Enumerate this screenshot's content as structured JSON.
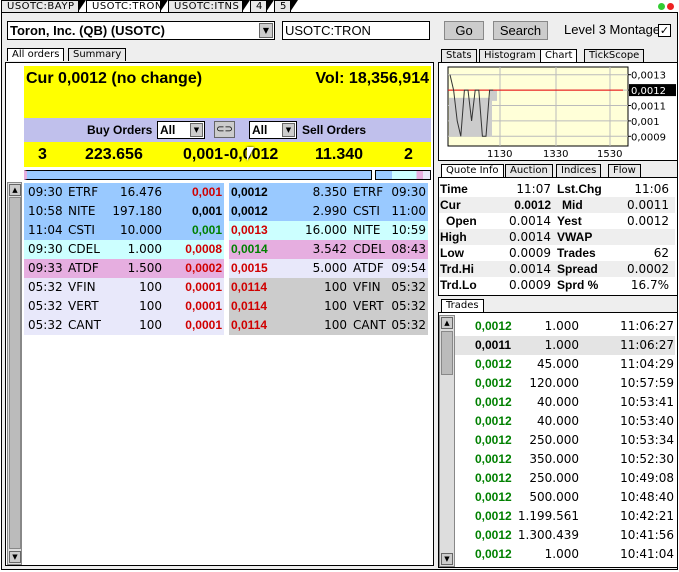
{
  "top_tabs": [
    "USOTC:BAYP",
    "USOTC:TRON",
    "USOTC:ITNS",
    "4",
    "5"
  ],
  "active_top_tab": 1,
  "symbol": {
    "name": "Toron, Inc. (QB) (USOTC)",
    "input": "USOTC:TRON",
    "go": "Go",
    "search": "Search",
    "montage_label": "Level 3 Montage",
    "montage_checked": true
  },
  "left_tabs": [
    "All orders",
    "Summary"
  ],
  "header": {
    "cur": "Cur 0,0012 (no change)",
    "vol": "Vol: 18,356,914"
  },
  "filter": {
    "buy_label": "Buy Orders",
    "buy_value": "All",
    "sell_value": "All",
    "sell_label": "Sell Orders"
  },
  "summary": {
    "buy_count": "3",
    "buy_volume": "223.656",
    "bid": "0,001",
    "ask": "-0,0012",
    "sell_volume": "11.340",
    "sell_count": "2"
  },
  "buy_orders": [
    {
      "time": "09:30",
      "mm": "ETRF",
      "size": "16.476",
      "price": "0,001",
      "color": "red",
      "bg": "#99c9ff"
    },
    {
      "time": "10:58",
      "mm": "NITE",
      "size": "197.180",
      "price": "0,001",
      "color": "black",
      "bg": "#99c9ff"
    },
    {
      "time": "11:04",
      "mm": "CSTI",
      "size": "10.000",
      "price": "0,001",
      "color": "green",
      "bg": "#99c9ff"
    },
    {
      "time": "09:30",
      "mm": "CDEL",
      "size": "1.000",
      "price": "0,0008",
      "color": "red",
      "bg": "#ccffff"
    },
    {
      "time": "09:33",
      "mm": "ATDF",
      "size": "1.500",
      "price": "0,0002",
      "color": "red",
      "bg": "#e6aee0"
    },
    {
      "time": "05:32",
      "mm": "VFIN",
      "size": "100",
      "price": "0,0001",
      "color": "red",
      "bg": "#e8e8fa"
    },
    {
      "time": "05:32",
      "mm": "VERT",
      "size": "100",
      "price": "0,0001",
      "color": "red",
      "bg": "#e8e8fa"
    },
    {
      "time": "05:32",
      "mm": "CANT",
      "size": "100",
      "price": "0,0001",
      "color": "red",
      "bg": "#e8e8fa"
    }
  ],
  "sell_orders": [
    {
      "price": "0,0012",
      "size": "8.350",
      "mm": "ETRF",
      "time": "09:30",
      "color": "black",
      "bg": "#99c9ff"
    },
    {
      "price": "0,0012",
      "size": "2.990",
      "mm": "CSTI",
      "time": "11:00",
      "color": "black",
      "bg": "#99c9ff"
    },
    {
      "price": "0,0013",
      "size": "16.000",
      "mm": "NITE",
      "time": "10:59",
      "color": "red",
      "bg": "#ccffff"
    },
    {
      "price": "0,0014",
      "size": "3.542",
      "mm": "CDEL",
      "time": "08:43",
      "color": "green",
      "bg": "#e6aee0"
    },
    {
      "price": "0,0015",
      "size": "5.000",
      "mm": "ATDF",
      "time": "09:54",
      "color": "red",
      "bg": "#e8e8fa"
    },
    {
      "price": "0,0114",
      "size": "100",
      "mm": "VFIN",
      "time": "05:32",
      "color": "red",
      "bg": "#cccccc"
    },
    {
      "price": "0,0114",
      "size": "100",
      "mm": "VERT",
      "time": "05:32",
      "color": "red",
      "bg": "#cccccc"
    },
    {
      "price": "0,0114",
      "size": "100",
      "mm": "CANT",
      "time": "05:32",
      "color": "red",
      "bg": "#cccccc"
    }
  ],
  "right_tabs": [
    "Stats",
    "Histogram",
    "Chart",
    "TickScope"
  ],
  "active_right_tab": 2,
  "chart_data": {
    "type": "line",
    "y_ticks": [
      "0,0013",
      "0,0012",
      "0,0011",
      "0,001",
      "0,0009"
    ],
    "y_values": [
      0.0013,
      0.0012,
      0.0011,
      0.001,
      0.0009
    ],
    "current_label": "0,0012",
    "current": 0.0012,
    "x_ticks": [
      "1130",
      "1330",
      "1530"
    ],
    "series": [
      0.0013,
      0.0012,
      0.001,
      0.0009,
      0.0012,
      0.0012,
      0.001,
      0.0012,
      0.0012,
      0.0009,
      0.0009,
      0.0012,
      0.0012
    ]
  },
  "quote_tabs": [
    "Quote Info",
    "Auction",
    "Indices",
    "Flow"
  ],
  "quote": [
    [
      "Time",
      "11:07",
      "Lst.Chg",
      "11:06"
    ],
    [
      "Cur",
      "0.0012",
      "Mid",
      "0.0011"
    ],
    [
      "Open",
      "0.0014",
      "Yest",
      "0.0012"
    ],
    [
      "High",
      "0.0014",
      "VWAP",
      ""
    ],
    [
      "Low",
      "0.0009",
      "Trades",
      "62"
    ],
    [
      "Trd.Hi",
      "0.0014",
      "Spread",
      "0.0002"
    ],
    [
      "Trd.Lo",
      "0.0009",
      "Sprd %",
      "16.7%"
    ]
  ],
  "trades_tab": "Trades",
  "trades": [
    {
      "price": "0,0012",
      "size": "1.000",
      "time": "11:06:27",
      "color": "green"
    },
    {
      "price": "0,0011",
      "size": "1.000",
      "time": "11:06:27",
      "color": "black"
    },
    {
      "price": "0,0012",
      "size": "45.000",
      "time": "11:04:29",
      "color": "green"
    },
    {
      "price": "0,0012",
      "size": "120.000",
      "time": "10:57:59",
      "color": "green"
    },
    {
      "price": "0,0012",
      "size": "40.000",
      "time": "10:53:41",
      "color": "green"
    },
    {
      "price": "0,0012",
      "size": "40.000",
      "time": "10:53:40",
      "color": "green"
    },
    {
      "price": "0,0012",
      "size": "250.000",
      "time": "10:53:34",
      "color": "green"
    },
    {
      "price": "0,0012",
      "size": "350.000",
      "time": "10:52:30",
      "color": "green"
    },
    {
      "price": "0,0012",
      "size": "250.000",
      "time": "10:49:08",
      "color": "green"
    },
    {
      "price": "0,0012",
      "size": "500.000",
      "time": "10:48:40",
      "color": "green"
    },
    {
      "price": "0,0012",
      "size": "1.199.561",
      "time": "10:42:21",
      "color": "green"
    },
    {
      "price": "0,0012",
      "size": "1.300.439",
      "time": "10:41:56",
      "color": "green"
    },
    {
      "price": "0,0012",
      "size": "1.000",
      "time": "10:41:04",
      "color": "green"
    }
  ]
}
